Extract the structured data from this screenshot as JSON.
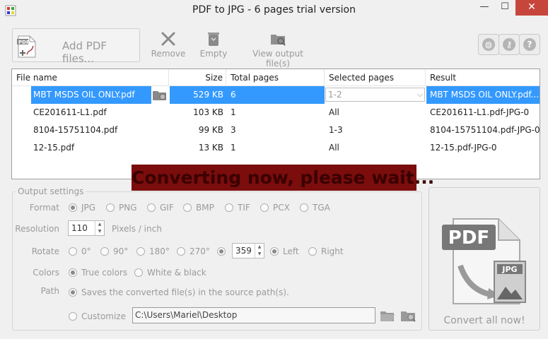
{
  "window": {
    "title": "PDF to JPG - 6 pages trial version",
    "minimize": "—",
    "maximize": "☐",
    "close": "✕"
  },
  "toolbar": {
    "add_pdf": "Add PDF files...",
    "remove": "Remove",
    "empty": "Empty",
    "view_output": "View output file(s)",
    "right_icons": [
      "globe-icon",
      "key-icon",
      "help-icon"
    ]
  },
  "table": {
    "headers": {
      "file_name": "File name",
      "size": "Size",
      "total_pages": "Total pages",
      "selected_pages": "Selected pages",
      "result": "Result"
    },
    "rows": [
      {
        "file": "MBT MSDS OIL ONLY.pdf",
        "size": "529 KB",
        "total": "6",
        "selected": "1-2",
        "result": "MBT MSDS OIL ONLY.pdf..."
      },
      {
        "file": "CE201611-L1.pdf",
        "size": "103 KB",
        "total": "1",
        "selected": "All",
        "result": "CE201611-L1.pdf-JPG-0"
      },
      {
        "file": "8104-15751104.pdf",
        "size": "99 KB",
        "total": "3",
        "selected": "1-3",
        "result": "8104-15751104.pdf-JPG-0"
      },
      {
        "file": "12-15.pdf",
        "size": "13 KB",
        "total": "1",
        "selected": "All",
        "result": "12-15.pdf-JPG-0"
      }
    ]
  },
  "banner": "Converting now, please wait...",
  "settings": {
    "title": "Output settings",
    "format_label": "Format",
    "formats": [
      "JPG",
      "PNG",
      "GIF",
      "BMP",
      "TIF",
      "PCX",
      "TGA"
    ],
    "format_selected": "JPG",
    "resolution_label": "Resolution",
    "resolution_value": "110",
    "resolution_unit": "Pixels / inch",
    "rotate_label": "Rotate",
    "rotate_options": [
      "0°",
      "90°",
      "180°",
      "270°"
    ],
    "rotate_custom_value": "359",
    "rotate_dir": [
      "Left",
      "Right"
    ],
    "colors_label": "Colors",
    "colors_options": [
      "True colors",
      "White & black"
    ],
    "path_label": "Path",
    "path_source": "Saves the converted file(s) in the source path(s).",
    "path_customize": "Customize",
    "path_value": "C:\\Users\\Mariel\\Desktop"
  },
  "convert": {
    "label": "Convert all now!",
    "pdf_text": "PDF",
    "jpg_text": "JPG"
  }
}
